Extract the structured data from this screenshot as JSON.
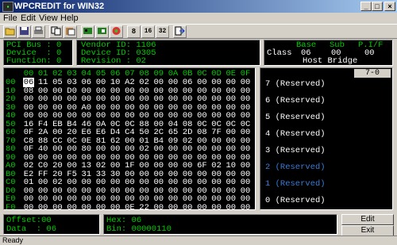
{
  "title": "WPCREDIT for WIN32",
  "menu": [
    "File",
    "Edit",
    "View",
    "Help"
  ],
  "window_buttons": [
    "_",
    "□",
    "×"
  ],
  "toolbar": [
    "open",
    "save",
    "print",
    "copy",
    "paste",
    "pci",
    "bar",
    "exec",
    "8",
    "16",
    "32",
    "export"
  ],
  "pci": {
    "bus_label": "PCI Bus :",
    "bus": "0",
    "device_label": "Device  :",
    "device": "0",
    "function_label": "Function:",
    "function": "0"
  },
  "ids": {
    "vendor_label": "Vendor ID:",
    "vendor": "1106",
    "device_label": "Device ID:",
    "device": "0305",
    "revision_label": "Revision :",
    "revision": "02"
  },
  "classinfo": {
    "headers": [
      "Base",
      "Sub",
      "P.I/F"
    ],
    "label": "Class",
    "values": [
      "06",
      "00",
      "00"
    ],
    "name": "Host Bridge"
  },
  "hex": {
    "col_headers": [
      "00",
      "01",
      "02",
      "03",
      "04",
      "05",
      "06",
      "07",
      "08",
      "09",
      "0A",
      "0B",
      "0C",
      "0D",
      "0E",
      "0F"
    ],
    "rows": [
      {
        "addr": "00",
        "bytes": [
          "06",
          "11",
          "05",
          "03",
          "06",
          "00",
          "10",
          "A2",
          "02",
          "00",
          "00",
          "06",
          "00",
          "00",
          "00",
          "00"
        ]
      },
      {
        "addr": "10",
        "bytes": [
          "08",
          "00",
          "00",
          "D0",
          "00",
          "00",
          "00",
          "00",
          "00",
          "00",
          "00",
          "00",
          "00",
          "00",
          "00",
          "00"
        ]
      },
      {
        "addr": "20",
        "bytes": [
          "00",
          "00",
          "00",
          "00",
          "00",
          "00",
          "00",
          "00",
          "00",
          "00",
          "00",
          "00",
          "00",
          "00",
          "00",
          "00"
        ]
      },
      {
        "addr": "30",
        "bytes": [
          "00",
          "00",
          "00",
          "00",
          "A0",
          "00",
          "00",
          "00",
          "00",
          "00",
          "00",
          "00",
          "00",
          "00",
          "00",
          "00"
        ]
      },
      {
        "addr": "40",
        "bytes": [
          "00",
          "00",
          "00",
          "00",
          "00",
          "00",
          "00",
          "00",
          "00",
          "00",
          "00",
          "00",
          "00",
          "00",
          "00",
          "00"
        ]
      },
      {
        "addr": "50",
        "bytes": [
          "16",
          "F4",
          "EB",
          "B4",
          "46",
          "0A",
          "0C",
          "0C",
          "88",
          "00",
          "04",
          "08",
          "0C",
          "0C",
          "0C",
          "0C"
        ]
      },
      {
        "addr": "60",
        "bytes": [
          "0F",
          "2A",
          "00",
          "20",
          "E6",
          "E6",
          "D4",
          "C4",
          "50",
          "2C",
          "65",
          "2D",
          "08",
          "7F",
          "00",
          "00"
        ]
      },
      {
        "addr": "70",
        "bytes": [
          "C8",
          "88",
          "CC",
          "0C",
          "0E",
          "81",
          "62",
          "00",
          "01",
          "B4",
          "09",
          "02",
          "00",
          "00",
          "00",
          "00"
        ]
      },
      {
        "addr": "80",
        "bytes": [
          "0F",
          "40",
          "00",
          "00",
          "80",
          "00",
          "00",
          "00",
          "02",
          "00",
          "00",
          "00",
          "00",
          "00",
          "00",
          "00"
        ]
      },
      {
        "addr": "90",
        "bytes": [
          "00",
          "00",
          "00",
          "00",
          "00",
          "00",
          "00",
          "00",
          "00",
          "00",
          "00",
          "00",
          "00",
          "00",
          "00",
          "00"
        ]
      },
      {
        "addr": "A0",
        "bytes": [
          "02",
          "C0",
          "20",
          "00",
          "13",
          "02",
          "00",
          "1F",
          "00",
          "00",
          "00",
          "00",
          "6F",
          "02",
          "10",
          "00"
        ]
      },
      {
        "addr": "B0",
        "bytes": [
          "E2",
          "FF",
          "20",
          "F5",
          "31",
          "33",
          "30",
          "00",
          "00",
          "00",
          "00",
          "00",
          "00",
          "00",
          "00",
          "00"
        ]
      },
      {
        "addr": "C0",
        "bytes": [
          "01",
          "00",
          "02",
          "00",
          "00",
          "00",
          "00",
          "00",
          "00",
          "00",
          "00",
          "00",
          "00",
          "00",
          "00",
          "00"
        ]
      },
      {
        "addr": "D0",
        "bytes": [
          "00",
          "00",
          "00",
          "00",
          "00",
          "00",
          "00",
          "00",
          "00",
          "00",
          "00",
          "00",
          "00",
          "00",
          "00",
          "00"
        ]
      },
      {
        "addr": "E0",
        "bytes": [
          "00",
          "00",
          "00",
          "00",
          "00",
          "00",
          "00",
          "00",
          "00",
          "00",
          "00",
          "00",
          "00",
          "00",
          "00",
          "00"
        ]
      },
      {
        "addr": "F0",
        "bytes": [
          "00",
          "00",
          "00",
          "00",
          "00",
          "00",
          "00",
          "0E",
          "22",
          "00",
          "00",
          "00",
          "00",
          "00",
          "00",
          "00"
        ]
      }
    ]
  },
  "bits": {
    "header": "7-0",
    "items": [
      "7 (Reserved)",
      "6 (Reserved)",
      "5 (Reserved)",
      "4 (Reserved)",
      "3 (Reserved)",
      "2 (Reserved)",
      "1 (Reserved)",
      "0 (Reserved)"
    ],
    "highlight": [
      5,
      6
    ]
  },
  "offset": {
    "offset_label": "Offset:",
    "offset": "00",
    "data_label": "Data  :",
    "data": "06"
  },
  "value": {
    "hex_label": "Hex:",
    "hex": "06",
    "bin_label": "Bin:",
    "bin": "00000110"
  },
  "buttons": {
    "edit": "Edit",
    "exit": "Exit"
  },
  "status": "Ready",
  "colors": {
    "green": "#00cc00",
    "white": "#ffffff",
    "blue": "#3a7bd5",
    "title": "#0a246a"
  }
}
